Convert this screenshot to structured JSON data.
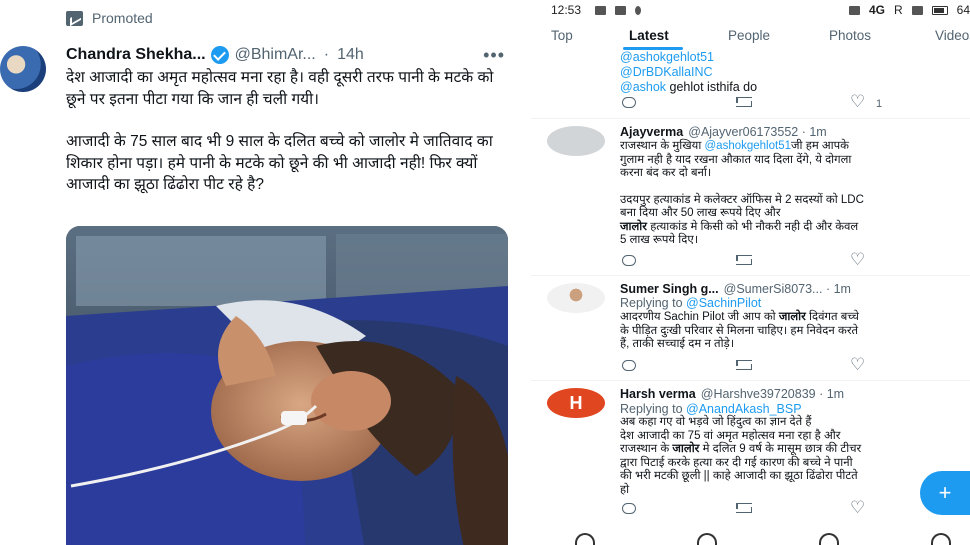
{
  "left": {
    "promoted": "Promoted",
    "tweet": {
      "name": "Chandra Shekha...",
      "handle": "@BhimAr...",
      "dot": "·",
      "time": "14h",
      "more": "•••",
      "paragraph_1": "देश आजादी का अमृत महोत्सव मना रहा है। वही दूसरी तरफ पानी के मटके को छूने पर इतना पीटा गया कि जान ही चली गयी।",
      "paragraph_2": "आजादी के 75 साल बाद भी 9 साल के दलित बच्चे को जालोर मे जातिवाद का शिकार होना पड़ा। हमे पानी के मटके को छूने की भी आजादी नही! फिर क्यों आजादी का झूठा ढिंढोरा पीट रहे है?"
    }
  },
  "right": {
    "status": {
      "time": "12:53",
      "network": "4G",
      "r": "R",
      "battery": "64"
    },
    "tabs": [
      "Top",
      "Latest",
      "People",
      "Photos",
      "Videos"
    ],
    "top_tweet": {
      "mention_1": "@ashokgehlot51",
      "mention_2": "@DrBDKallaINC",
      "mention_3": "@ashok",
      "text_3": " gehlot isthifa do",
      "like_count": "1"
    },
    "replies": [
      {
        "name": "Ajayverma",
        "meta": "@Ajayver06173552 · 1m",
        "line1_pre": "राजस्थान के मुखिया ",
        "line1_mention": "@ashokgehlot51",
        "line1_post": "जी हम आपके",
        "line2": "गुलाम नही है याद रखना औकात याद दिला देंगे, ये दोगला",
        "line3": "करना बंद कर दो बर्ना।",
        "line4": "उदयपुर हत्याकांड मे कलेक्टर ऑफिस मे 2 सदस्यों को LDC",
        "line5": "बना दिया और 50 लाख रूपये दिए और",
        "line6_bold": "जालोर",
        "line6_rest": " हत्याकांड मे किसी को भी नौकरी नही दी और केवल",
        "line7": "5 लाख रूपये दिए।"
      },
      {
        "name": "Sumer Singh g...",
        "meta": "@SumerSi8073... · 1m",
        "replying_label": "Replying to ",
        "replying_to": "@SachinPilot",
        "line1_pre": "आदरणीय Sachin Pilot जी आप को ",
        "line1_bold": "जालोर",
        "line1_post": " दिवंगत बच्चे",
        "line2": "के पीड़ित दुःखी परिवार से मिलना चाहिए। हम निवेदन करते",
        "line3": "हैं, ताकी सच्चाई दम न तोड़े।"
      },
      {
        "name": "Harsh verma",
        "meta": "@Harshve39720839 · 1m",
        "avatar_letter": "H",
        "replying_label": "Replying to ",
        "replying_to": "@AnandAkash_BSP",
        "line1": "अब कहा गए वो भड़वे जो हिंदुत्व का ज्ञान देते हैं",
        "line2": "देश आजादी का 75 वां अमृत महोत्सव मना रहा है और",
        "line3_pre": "राजस्थान के ",
        "line3_bold": "जालोर",
        "line3_post": " मे दलित 9 वर्ष के मासूम छात्र की टीचर",
        "line4": "द्वारा पिटाई करके हत्या कर दी गई  कारण की बच्चे ने पानी",
        "line5": "की भरी मटकी छूली || काहे आजादी का झूठा ढिंढोरा पीटते",
        "line6": "हो"
      }
    ],
    "fab_symbol": "+"
  }
}
